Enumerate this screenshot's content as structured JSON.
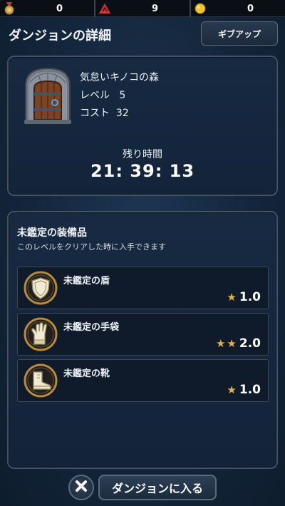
{
  "resources": [
    {
      "icon": "medal-icon",
      "value": "0"
    },
    {
      "icon": "warning-icon",
      "value": "9"
    },
    {
      "icon": "coin-icon",
      "value": "0"
    }
  ],
  "header": {
    "title": "ダンジョンの詳細",
    "give_up_label": "ギブアップ"
  },
  "dungeon": {
    "name": "気怠いキノコの森",
    "level_label": "レベル",
    "level": "5",
    "cost_label": "コスト",
    "cost": "32",
    "remaining_label": "残り時間",
    "remaining_time": "21: 39: 13"
  },
  "equipment": {
    "title": "未鑑定の装備品",
    "subtitle": "このレベルをクリアした時に入手できます",
    "items": [
      {
        "name": "未鑑定の盾",
        "icon": "shield-icon",
        "stars": 1,
        "rating": "1.0"
      },
      {
        "name": "未鑑定の手袋",
        "icon": "glove-icon",
        "stars": 2,
        "rating": "2.0"
      },
      {
        "name": "未鑑定の靴",
        "icon": "boot-icon",
        "stars": 1,
        "rating": "1.0"
      }
    ]
  },
  "footer": {
    "enter_label": "ダンジョンに入る"
  },
  "colors": {
    "star": "#e3b248",
    "medal_gold": "#c8a24a",
    "warning_red": "#d83a3a",
    "coin_yellow": "#f2c230"
  }
}
